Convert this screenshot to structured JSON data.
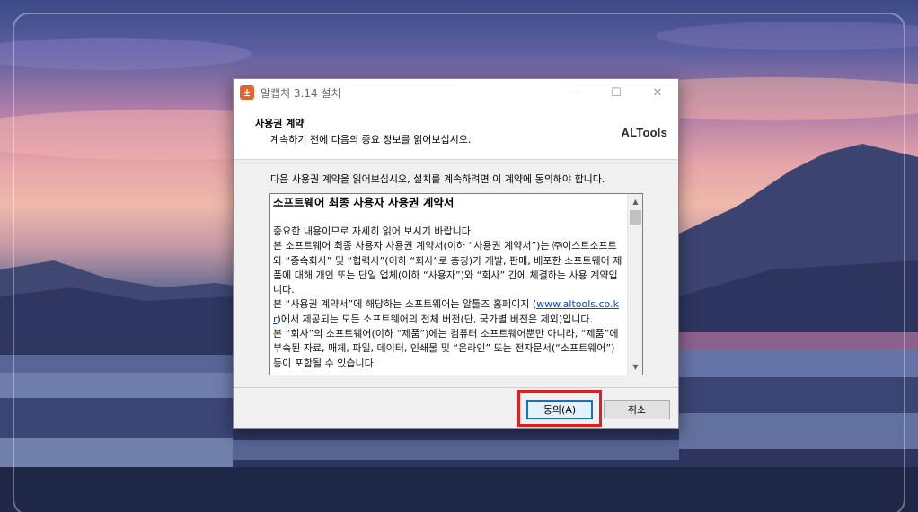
{
  "window": {
    "title": "알캡처 3.14 설치",
    "controls": {
      "minimize": "—",
      "maximize": "☐",
      "close": "✕"
    }
  },
  "header": {
    "title": "사용권 계약",
    "subtitle": "계속하기 전에 다음의 중요 정보를 읽어보십시오.",
    "brand": "ALTools"
  },
  "instruction": "다음 사용권 계약을 읽어보십시오, 설치를 계속하려면 이 계약에 동의해야 합니다.",
  "license": {
    "heading": "소프트웨어 최종 사용자 사용권 계약서",
    "intro": "중요한 내용이므로 자세히 읽어 보시기 바랍니다.",
    "para1": "본 소프트웨어 최종 사용자 사용권 계약서(이하 “사용권 계약서”)는 ㈜이스트소프트와 “종속회사” 및 “협력사”(이하 “회사”로 총칭)가 개발, 판매, 배포한 소프트웨어 제품에 대해 개인 또는 단일 업체(이하 “사용자”)와 “회사” 간에 체결하는 사용 계약입니다.",
    "para2_before": "본 “사용권 계약서”에 해당하는 소프트웨어는 알툴즈 홈페이지 (",
    "para2_link": "www.altools.co.kr",
    "para2_after": ")에서 제공되는 모든 소프트웨어의 전체 버전(단, 국가별 버전은 제외)입니다.",
    "para3": "본 “회사”의 소프트웨어(이하 “제품”)에는 컴퓨터 소프트웨어뿐만 아니라, “제품”에 부속된 자료, 매체, 파일, 데이터, 인쇄물 및 “온라인” 또는 전자문서(“소프트웨어”) 등이 포함될 수 있습니다."
  },
  "buttons": {
    "agree": "동의(A)",
    "cancel": "취소"
  },
  "colors": {
    "focus_border": "#0078d7",
    "highlight_box": "#e01e1e",
    "app_icon": "#e6632b"
  }
}
